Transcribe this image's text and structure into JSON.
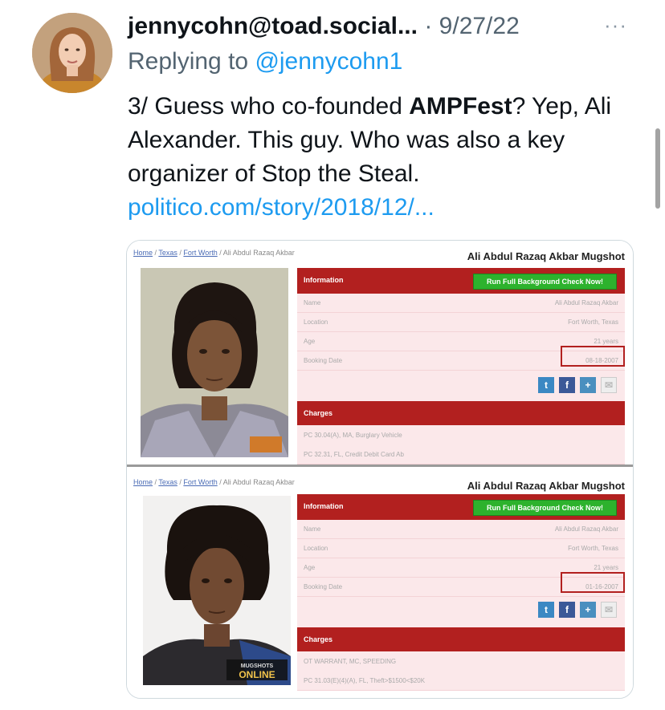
{
  "tweet": {
    "handle": "jennycohn@toad.social...",
    "separator": "·",
    "date": "9/27/22",
    "more": "···",
    "replying_prefix": "Replying to ",
    "replying_mention": "@jennycohn1",
    "text_part1": "3/ Guess who co-founded ",
    "text_bold": "AMPFest",
    "text_part2": "? Yep, Ali Alexander. This guy. Who was also a key organizer of Stop the Steal.",
    "link": "politico.com/story/2018/12/..."
  },
  "media": {
    "panels": [
      {
        "crumb_home": "Home",
        "crumb_state": "Texas",
        "crumb_city": "Fort Worth",
        "crumb_name": "Ali Abdul Razaq Akbar",
        "title": "Ali Abdul Razaq Akbar Mugshot",
        "info_label": "Information",
        "bg_button": "Run Full Background Check Now!",
        "rows": [
          {
            "k": "Name",
            "v": "Ali Abdul Razaq Akbar"
          },
          {
            "k": "Location",
            "v": "Fort Worth, Texas"
          },
          {
            "k": "Age",
            "v": "21 years"
          },
          {
            "k": "Booking Date",
            "v": "08-18-2007"
          }
        ],
        "charges_label": "Charges",
        "charges": [
          "PC 30.04(A), MA, Burglary Vehicle",
          "PC 32.31, FL, Credit Debit Card Ab"
        ]
      },
      {
        "crumb_home": "Home",
        "crumb_state": "Texas",
        "crumb_city": "Fort Worth",
        "crumb_name": "Ali Abdul Razaq Akbar",
        "title": "Ali Abdul Razaq Akbar Mugshot",
        "info_label": "Information",
        "bg_button": "Run Full Background Check Now!",
        "rows": [
          {
            "k": "Name",
            "v": "Ali Abdul Razaq Akbar"
          },
          {
            "k": "Location",
            "v": "Fort Worth, Texas"
          },
          {
            "k": "Age",
            "v": "21 years"
          },
          {
            "k": "Booking Date",
            "v": "01-16-2007"
          }
        ],
        "charges_label": "Charges",
        "charges": [
          "OT WARRANT, MC, SPEEDING",
          "PC 31.03(E)(4)(A), FL, Theft>$1500<$20K"
        ],
        "watermark": "MUGSHOTS ONLINE"
      }
    ]
  },
  "colors": {
    "link": "#1d9bf0",
    "muted": "#536471",
    "mugshot_red": "#b2201f",
    "button_green": "#2db22d"
  },
  "icons": [
    "avatar",
    "more-icon",
    "twitter-icon",
    "facebook-icon",
    "share-icon",
    "email-icon"
  ]
}
